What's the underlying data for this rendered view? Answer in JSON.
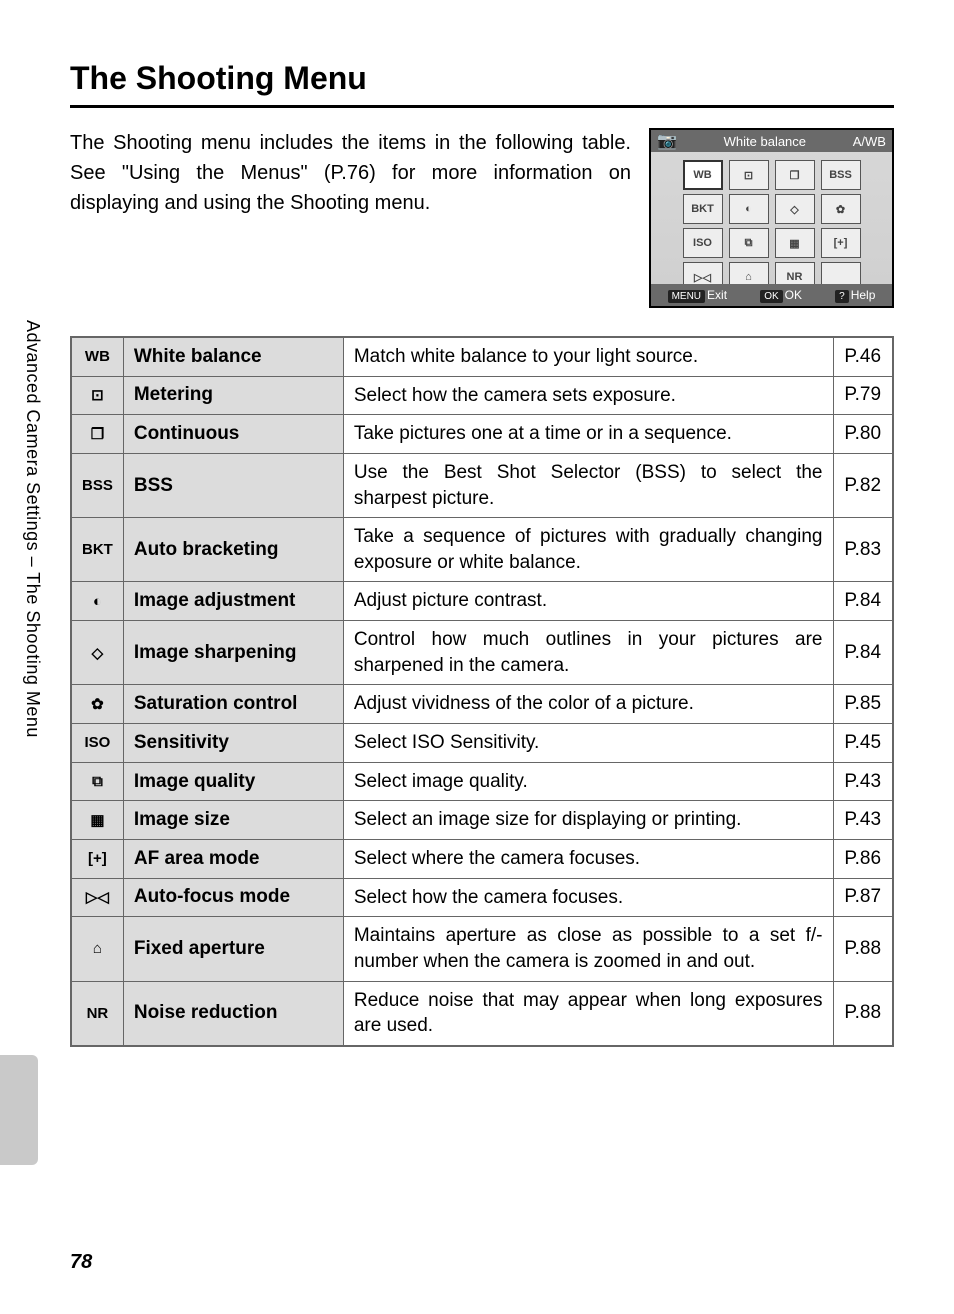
{
  "title": "The Shooting Menu",
  "intro": "The Shooting menu includes the items in the following table. See \"Using the Menus\" (P.76) for more information on displaying and using the Shooting menu.",
  "side_label": "Advanced Camera Settings – The Shooting Menu",
  "page_number": "78",
  "screen": {
    "header_title": "White balance",
    "cam_icon": "📷",
    "header_badge": "A/WB",
    "grid": [
      "WB",
      "⊡",
      "❐",
      "BSS",
      "BKT",
      "◐",
      "◇",
      "✿",
      "ISO",
      "⧉",
      "▦",
      "[+]",
      "▷◁",
      "⌂",
      "NR",
      ""
    ],
    "footer": {
      "exit_tag": "MENU",
      "exit": "Exit",
      "ok_tag": "OK",
      "ok": "OK",
      "help_tag": "?",
      "help": "Help"
    }
  },
  "rows": [
    {
      "icon": "WB",
      "name": "White balance",
      "desc": "Match white balance to your light source.",
      "page": "P.46"
    },
    {
      "icon": "⊡",
      "name": "Metering",
      "desc": "Select how the camera sets exposure.",
      "page": "P.79"
    },
    {
      "icon": "❐",
      "name": "Continuous",
      "desc": "Take pictures one at a time or in a sequence.",
      "page": "P.80"
    },
    {
      "icon": "BSS",
      "name": "BSS",
      "desc": "Use the Best Shot Selector (BSS) to select the sharpest picture.",
      "page": "P.82"
    },
    {
      "icon": "BKT",
      "name": "Auto bracketing",
      "desc": "Take a sequence of pictures with gradually changing exposure or white balance.",
      "page": "P.83"
    },
    {
      "icon": "◐",
      "name": "Image adjustment",
      "desc": "Adjust picture contrast.",
      "page": "P.84"
    },
    {
      "icon": "◇",
      "name": "Image sharpening",
      "desc": "Control how much outlines in your pictures are sharpened in the camera.",
      "page": "P.84"
    },
    {
      "icon": "✿",
      "name": "Saturation control",
      "desc": "Adjust vividness of the color of a picture.",
      "page": "P.85"
    },
    {
      "icon": "ISO",
      "name": "Sensitivity",
      "desc": "Select ISO Sensitivity.",
      "page": "P.45"
    },
    {
      "icon": "⧉",
      "name": "Image quality",
      "desc": "Select image quality.",
      "page": "P.43"
    },
    {
      "icon": "▦",
      "name": "Image size",
      "desc": "Select an image size for displaying or printing.",
      "page": "P.43"
    },
    {
      "icon": "[+]",
      "name": "AF area mode",
      "desc": "Select where the camera focuses.",
      "page": "P.86"
    },
    {
      "icon": "▷◁",
      "name": "Auto-focus mode",
      "desc": "Select how the camera focuses.",
      "page": "P.87"
    },
    {
      "icon": "⌂",
      "name": "Fixed aperture",
      "desc": "Maintains aperture as close as possible to a set f/-number when the camera is zoomed in and out.",
      "page": "P.88"
    },
    {
      "icon": "NR",
      "name": "Noise reduction",
      "desc": "Reduce noise that may appear when long exposures are used.",
      "page": "P.88"
    }
  ]
}
